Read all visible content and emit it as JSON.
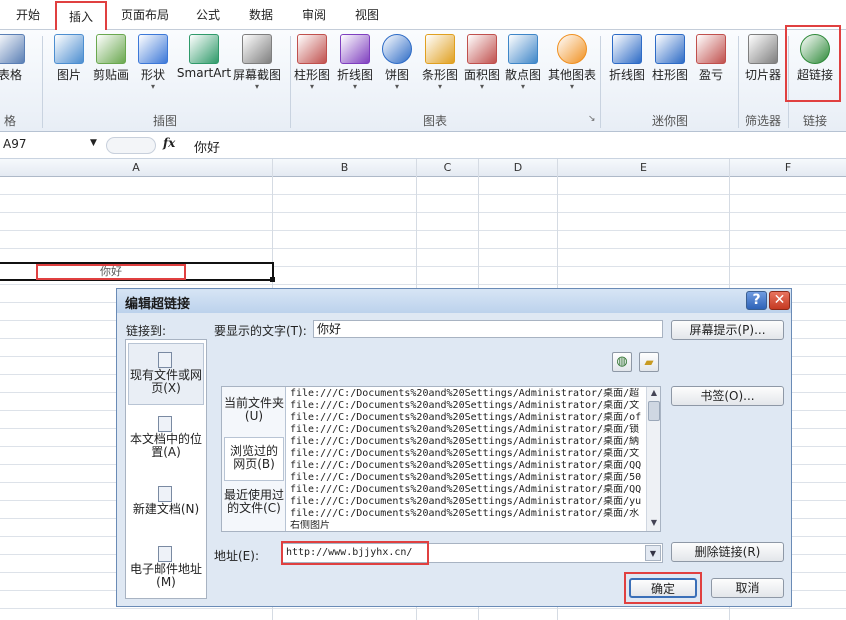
{
  "tabs": [
    "开始",
    "插入",
    "页面布局",
    "公式",
    "数据",
    "审阅",
    "视图"
  ],
  "ribbon": {
    "buttons": [
      {
        "label": "表格",
        "icon": "table-icon",
        "dd": ""
      },
      {
        "label": "图片",
        "icon": "picture-icon",
        "dd": ""
      },
      {
        "label": "剪贴画",
        "icon": "clipart-icon",
        "dd": ""
      },
      {
        "label": "形状",
        "icon": "shapes-icon",
        "dd": "▾"
      },
      {
        "label": "SmartArt",
        "icon": "smartart-icon",
        "dd": ""
      },
      {
        "label": "屏幕截图",
        "icon": "screenshot-icon",
        "dd": "▾"
      },
      {
        "label": "柱形图",
        "icon": "column-chart-icon",
        "dd": "▾"
      },
      {
        "label": "折线图",
        "icon": "line-chart-icon",
        "dd": "▾"
      },
      {
        "label": "饼图",
        "icon": "pie-chart-icon",
        "dd": "▾"
      },
      {
        "label": "条形图",
        "icon": "bar-chart-icon",
        "dd": "▾"
      },
      {
        "label": "面积图",
        "icon": "area-chart-icon",
        "dd": "▾"
      },
      {
        "label": "散点图",
        "icon": "scatter-chart-icon",
        "dd": "▾"
      },
      {
        "label": "其他图表",
        "icon": "other-chart-icon",
        "dd": "▾"
      },
      {
        "label": "折线图",
        "icon": "sparkline-line-icon",
        "dd": ""
      },
      {
        "label": "柱形图",
        "icon": "sparkline-column-icon",
        "dd": ""
      },
      {
        "label": "盈亏",
        "icon": "sparkline-winloss-icon",
        "dd": ""
      },
      {
        "label": "切片器",
        "icon": "slicer-icon",
        "dd": ""
      },
      {
        "label": "超链接",
        "icon": "hyperlink-icon",
        "dd": ""
      }
    ],
    "groups": [
      "格",
      "插图",
      "图表",
      "迷你图",
      "筛选器",
      "链接"
    ]
  },
  "formula_bar": {
    "cell_ref": "A97",
    "fx": "fx",
    "value": "你好"
  },
  "columns": [
    "A",
    "B",
    "C",
    "D",
    "E",
    "F"
  ],
  "cell": {
    "text": "你好"
  },
  "dialog": {
    "title": "编辑超链接",
    "help": "?",
    "close": "✕",
    "link_to_label": "链接到:",
    "nav": [
      "现有文件或网页(X)",
      "本文档中的位置(A)",
      "新建文档(N)",
      "电子邮件地址(M)"
    ],
    "display_text_label": "要显示的文字(T):",
    "display_text_value": "你好",
    "screen_tip_button": "屏幕提示(P)...",
    "subnav": [
      "当前文件夹(U)",
      "浏览过的网页(B)",
      "最近使用过的文件(C)"
    ],
    "files": [
      "file:///C:/Documents%20and%20Settings/Administrator/桌面/超",
      "file:///C:/Documents%20and%20Settings/Administrator/桌面/文",
      "file:///C:/Documents%20and%20Settings/Administrator/桌面/of",
      "file:///C:/Documents%20and%20Settings/Administrator/桌面/锁",
      "file:///C:/Documents%20and%20Settings/Administrator/桌面/納",
      "file:///C:/Documents%20and%20Settings/Administrator/桌面/文",
      "file:///C:/Documents%20and%20Settings/Administrator/桌面/QQ",
      "file:///C:/Documents%20and%20Settings/Administrator/桌面/50",
      "file:///C:/Documents%20and%20Settings/Administrator/桌面/QQ",
      "file:///C:/Documents%20and%20Settings/Administrator/桌面/yu",
      "file:///C:/Documents%20and%20Settings/Administrator/桌面/水",
      "右侧图片"
    ],
    "bookmark_button": "书签(O)...",
    "address_label": "地址(E):",
    "address_value": "http://www.bjjyhx.cn/",
    "remove_link_button": "删除链接(R)",
    "ok_button": "确定",
    "cancel_button": "取消"
  },
  "colors": {
    "highlight": "#e04040"
  }
}
